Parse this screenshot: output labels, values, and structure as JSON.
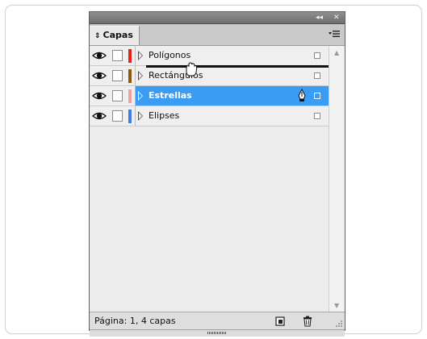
{
  "panel": {
    "titlebar_buttons": {
      "collapse": "◂◂",
      "close": "✕"
    },
    "tab_chevron": "⇕",
    "tab_label": "Capas",
    "menu_icon": "panel-menu-icon"
  },
  "layers": [
    {
      "label": "Polígonos",
      "color": "#e8221b",
      "selected": false
    },
    {
      "label": "Rectángulos",
      "color": "#8a5a14",
      "selected": false
    },
    {
      "label": "Estrellas",
      "color": "#f2a0a0",
      "selected": true
    },
    {
      "label": "Elipses",
      "color": "#3d7fe0",
      "selected": false
    }
  ],
  "status": {
    "text": "Página: 1, 4 capas",
    "new_layer_icon": "new-layer-icon",
    "delete_icon": "trash-icon"
  },
  "colors": {
    "selection": "#3b9cf3",
    "titlebar": "#7d7d7d"
  }
}
